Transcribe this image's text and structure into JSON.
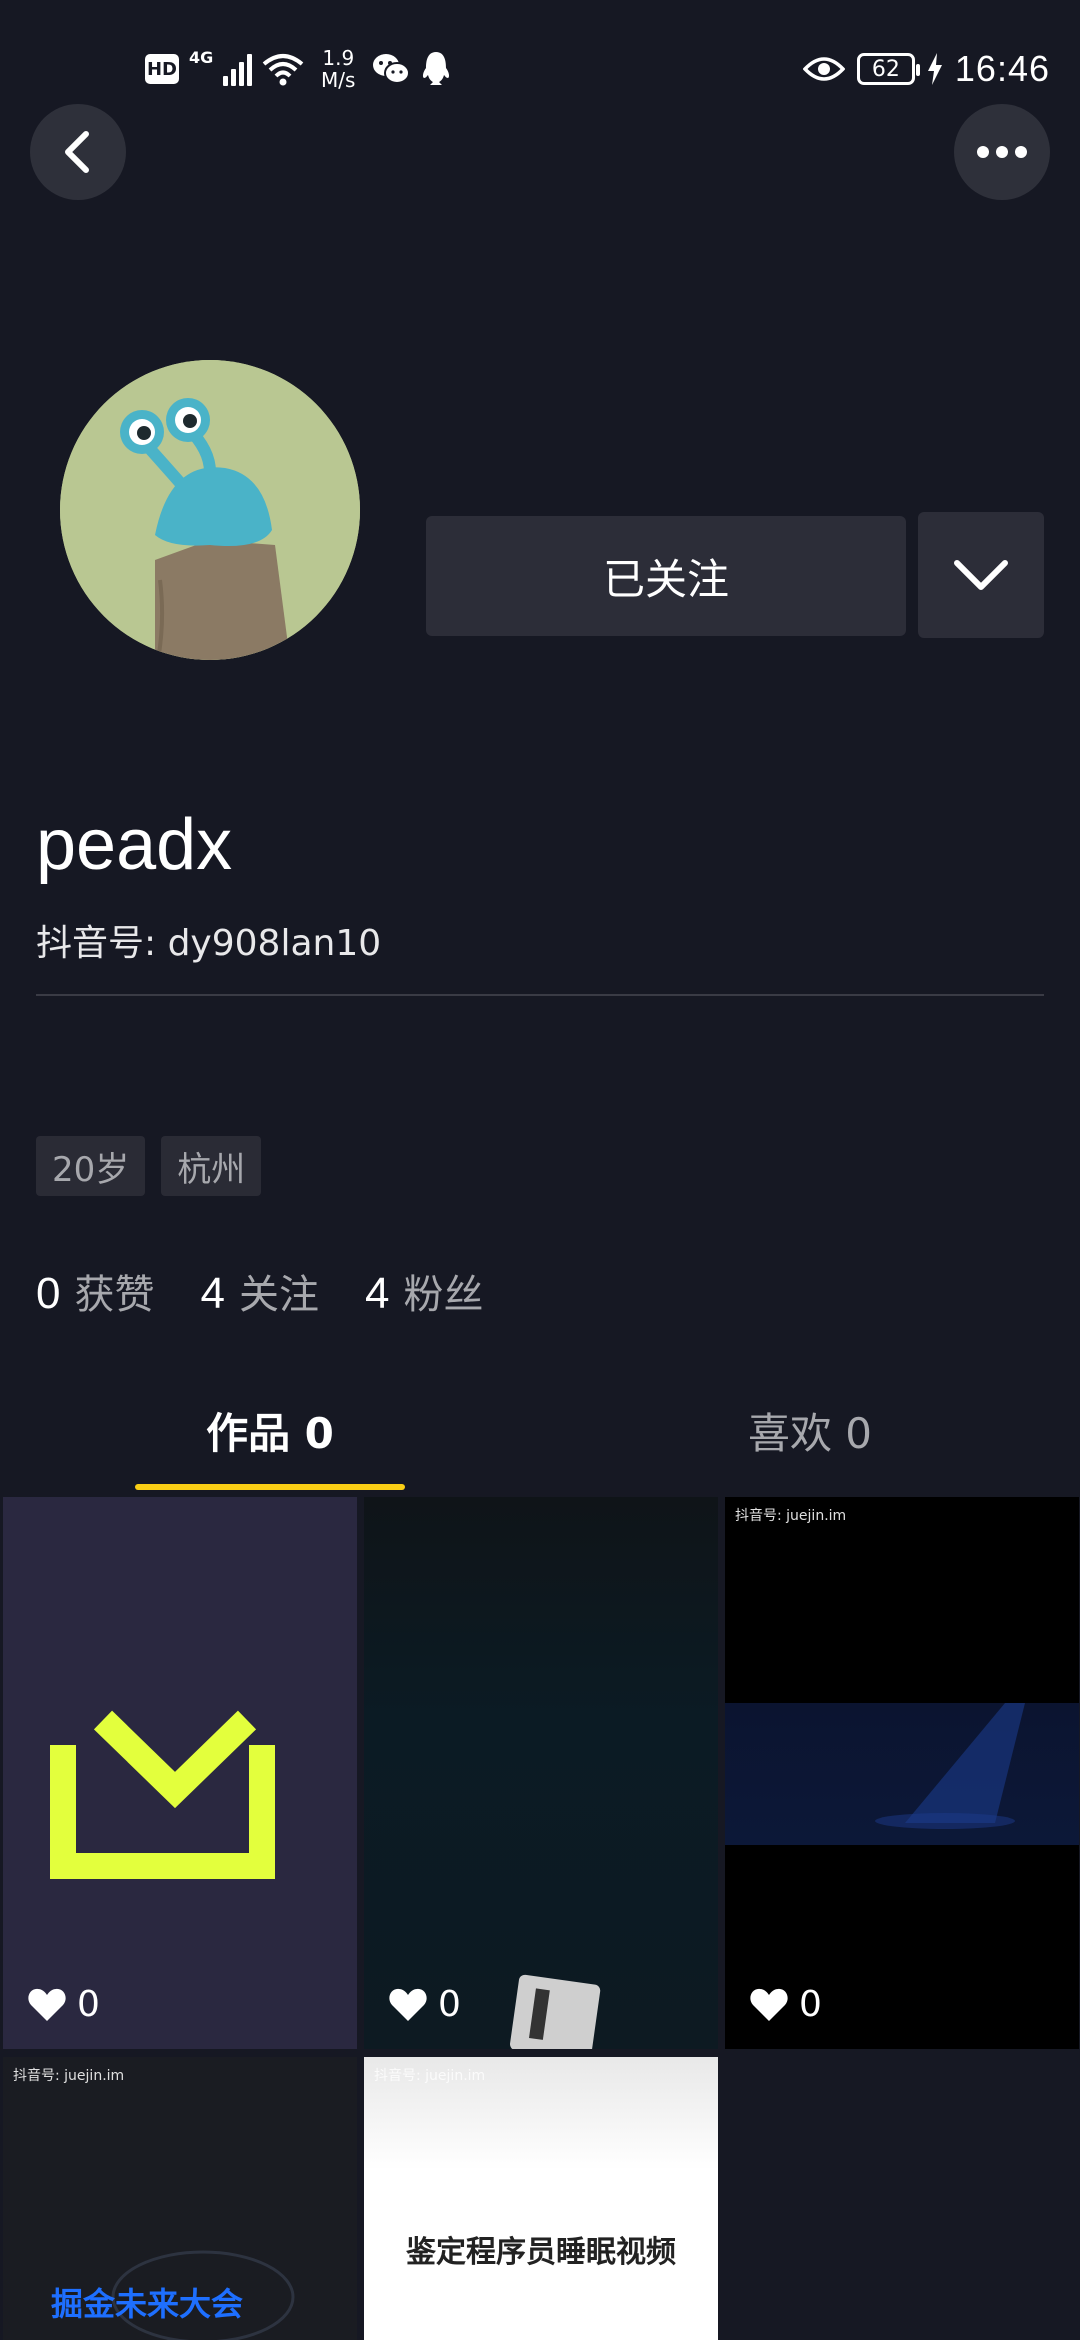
{
  "status_bar": {
    "hd": "HD",
    "network": "4G",
    "speed_value": "1.9",
    "speed_unit": "M/s",
    "battery": "62",
    "time": "16:46",
    "icons": [
      "hd-icon",
      "signal-icon",
      "wifi-icon",
      "wechat-icon",
      "qq-icon",
      "eye-icon",
      "battery-icon",
      "charging-icon"
    ]
  },
  "nav": {
    "back_icon": "chevron-left-icon",
    "more_icon": "more-dots-icon"
  },
  "profile": {
    "username": "peadx",
    "douyin_id": "抖音号: dy908lan10",
    "follow_label": "已关注",
    "dropdown_icon": "chevron-down-icon",
    "tags": [
      "20岁",
      "杭州"
    ]
  },
  "stats": [
    {
      "num": "0",
      "label": "获赞"
    },
    {
      "num": "4",
      "label": "关注"
    },
    {
      "num": "4",
      "label": "粉丝"
    }
  ],
  "tabs": {
    "works": "作品 0",
    "likes": "喜欢 0",
    "active_color": "#FACE15"
  },
  "videos": [
    {
      "likes": "0",
      "watermark": ""
    },
    {
      "likes": "0",
      "watermark": ""
    },
    {
      "likes": "0",
      "watermark": "抖音号: juejin.im"
    },
    {
      "likes": "",
      "watermark": "抖音号: juejin.im",
      "text": "掘金未来大会"
    },
    {
      "likes": "",
      "watermark": "抖音号: juejin.im",
      "text": "鉴定程序员睡眠视频"
    }
  ],
  "colors": {
    "background": "#161823",
    "button": "#2C2D38",
    "download_icon": "#E3FF3D",
    "secondary_text": "#A7A8AD"
  }
}
